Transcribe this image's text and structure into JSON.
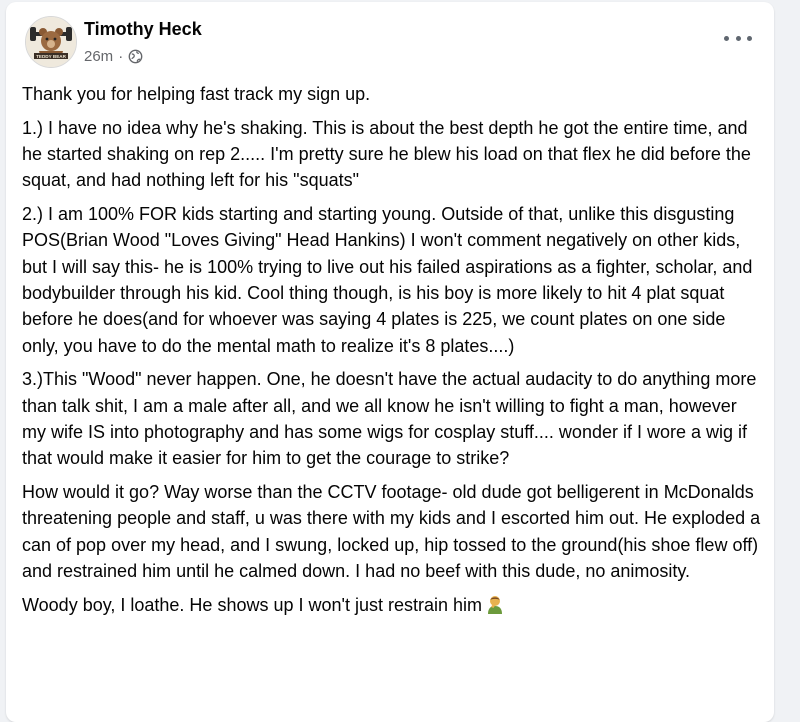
{
  "post": {
    "author": "Timothy Heck",
    "time": "26m",
    "privacy_icon": "globe-icon",
    "avatar_text": "TEDDY BEAR",
    "paragraphs": [
      "Thank you for helping fast track my sign up.",
      "1.) I have no idea why he's shaking. This is about the best depth he got the entire time, and he started shaking on rep 2..... I'm pretty sure he blew his load on that flex he did before the squat, and had nothing left for his \"squats\"",
      "2.) I am 100% FOR kids starting and starting young. Outside of that, unlike this disgusting POS(Brian Wood \"Loves Giving\" Head Hankins) I won't comment negatively on other kids, but I will say this- he is 100% trying to live out his failed aspirations as a fighter, scholar, and bodybuilder through his kid. Cool thing though, is his boy is more likely to hit 4 plat squat before he does(and for whoever was saying 4 plates is 225, we count plates on one side only, you have to do the mental math to realize it's 8 plates....)",
      "3.)This \"Wood\" never happen. One, he doesn't have the actual audacity to do anything more than talk shit, I am a male after all, and we all know he isn't willing to fight a man, however my wife IS into photography and has some wigs for cosplay stuff.... wonder if I wore a wig if that would make it easier for him to get the courage to strike?",
      "How would it go? Way worse than the CCTV footage- old dude got belligerent in McDonalds threatening people and staff, u was there with my kids and I escorted him out. He exploded a can of pop over my head, and I swung, locked up, hip tossed to the ground(his shoe flew off) and restrained him until he calmed down. I had no beef with this dude, no animosity.",
      "Woody boy, I loathe. He shows up I won't just restrain him"
    ],
    "last_emoji": "person-facepalming-emoji"
  }
}
